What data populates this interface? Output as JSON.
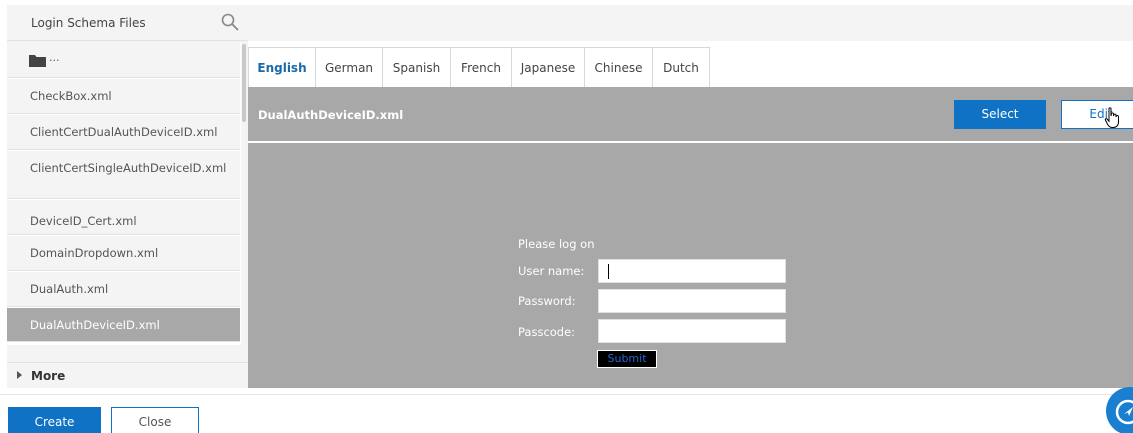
{
  "sidebar": {
    "search_label": "Login Schema Files",
    "folder_label": "...",
    "items": [
      {
        "label": "CheckBox.xml"
      },
      {
        "label": "ClientCertDualAuthDeviceID.xml"
      },
      {
        "label": "ClientCertSingleAuthDeviceID.xml"
      },
      {
        "label": "DeviceID_Cert.xml"
      },
      {
        "label": "DomainDropdown.xml"
      },
      {
        "label": "DualAuth.xml"
      },
      {
        "label": "DualAuthDeviceID.xml"
      }
    ],
    "selected_index": 6,
    "more_label": "More"
  },
  "tabs": [
    {
      "label": "English",
      "active": true
    },
    {
      "label": "German"
    },
    {
      "label": "Spanish"
    },
    {
      "label": "French"
    },
    {
      "label": "Japanese"
    },
    {
      "label": "Chinese"
    },
    {
      "label": "Dutch"
    }
  ],
  "preview": {
    "file_name": "DualAuthDeviceID.xml",
    "select_label": "Select",
    "edit_label": "Edit",
    "login_heading": "Please log on",
    "username_label": "User name:",
    "password_label": "Password:",
    "passcode_label": "Passcode:",
    "username_value": "",
    "password_value": "",
    "passcode_value": "",
    "submit_label": "Submit"
  },
  "footer": {
    "create_label": "Create",
    "close_label": "Close"
  },
  "colors": {
    "accent": "#0f72c4",
    "preview_bg": "#a8a8a8",
    "selected_bg": "#a8a8a8",
    "active_tab_text": "#1a6aa8"
  }
}
